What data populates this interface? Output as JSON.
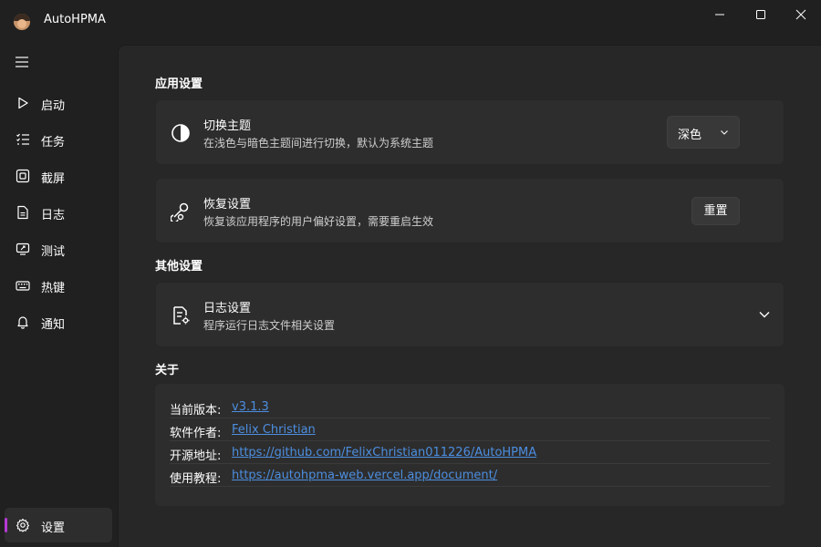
{
  "app": {
    "title": "AutoHPMA",
    "icon": "avatar-icon"
  },
  "window_controls": [
    "minimize-icon",
    "maximize-icon",
    "close-icon"
  ],
  "sidebar": {
    "menu_icon": "hamburger-icon",
    "items": [
      {
        "label": "启动",
        "icon": "play-icon"
      },
      {
        "label": "任务",
        "icon": "task-list-icon"
      },
      {
        "label": "截屏",
        "icon": "screenshot-icon"
      },
      {
        "label": "日志",
        "icon": "document-icon"
      },
      {
        "label": "测试",
        "icon": "test-icon"
      },
      {
        "label": "热键",
        "icon": "keyboard-icon"
      },
      {
        "label": "通知",
        "icon": "bell-icon"
      }
    ],
    "footer_item": {
      "label": "设置",
      "icon": "gear-icon",
      "active": true
    },
    "accent_color": "#b43ad3"
  },
  "main": {
    "app_settings": {
      "title": "应用设置",
      "theme": {
        "icon": "contrast-icon",
        "title": "切换主题",
        "description": "在浅色与暗色主题间进行切换，默认为系统主题",
        "selected": "深色"
      },
      "reset": {
        "icon": "reset-icon",
        "title": "恢复设置",
        "description": "恢复该应用程序的用户偏好设置，需要重启生效",
        "button_label": "重置"
      }
    },
    "other_settings": {
      "title": "其他设置",
      "log": {
        "icon": "log-settings-icon",
        "title": "日志设置",
        "description": "程序运行日志文件相关设置"
      }
    },
    "about": {
      "title": "关于",
      "rows": [
        {
          "key": "当前版本:",
          "value": "v3.1.3"
        },
        {
          "key": "软件作者:",
          "value": "Felix Christian"
        },
        {
          "key": "开源地址:",
          "value": "https://github.com/FelixChristian011226/AutoHPMA"
        },
        {
          "key": "使用教程:",
          "value": "https://autohpma-web.vercel.app/document/"
        }
      ],
      "link_color": "#4c8ee0"
    }
  }
}
